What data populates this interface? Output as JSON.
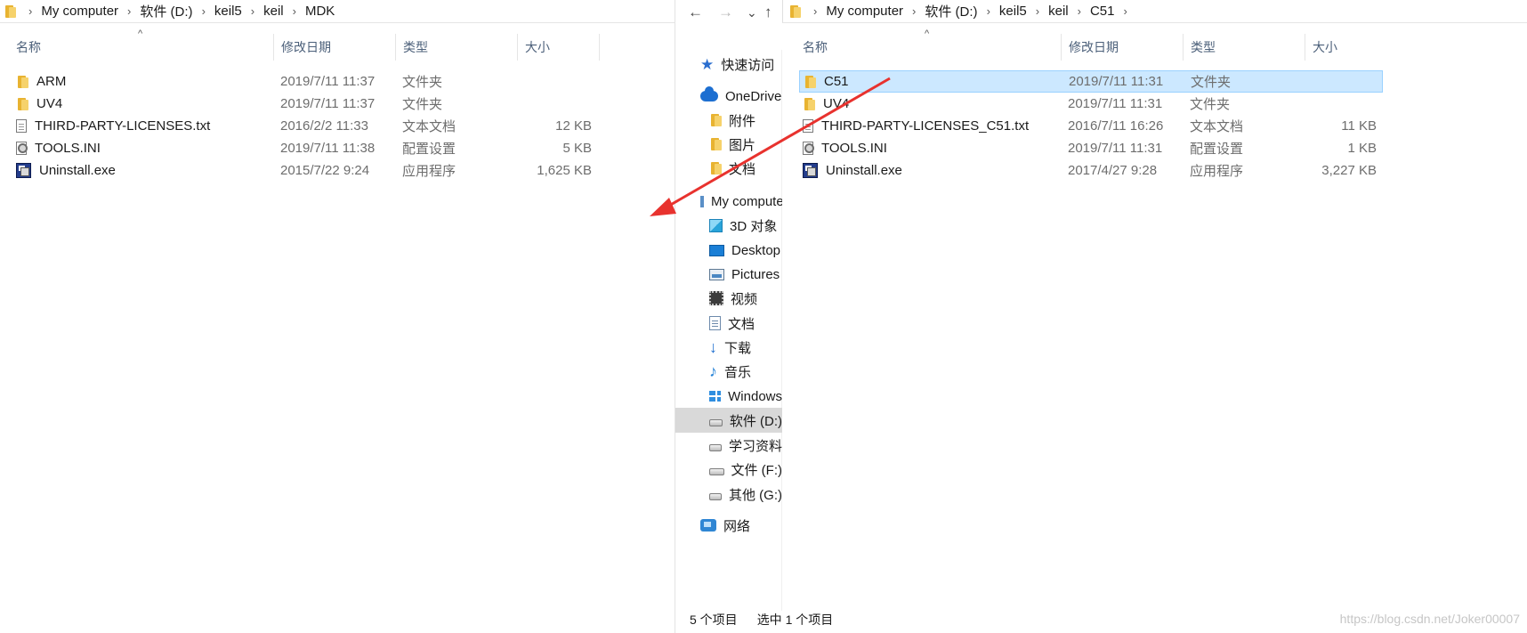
{
  "left": {
    "breadcrumb": [
      "My computer",
      "软件 (D:)",
      "keil5",
      "keil",
      "MDK"
    ],
    "columns": {
      "name": "名称",
      "date": "修改日期",
      "type": "类型",
      "size": "大小"
    },
    "files": [
      {
        "name": "ARM",
        "date": "2019/7/11 11:37",
        "type": "文件夹",
        "size": "",
        "icon": "folder-icon"
      },
      {
        "name": "UV4",
        "date": "2019/7/11 11:37",
        "type": "文件夹",
        "size": "",
        "icon": "folder-icon"
      },
      {
        "name": "THIRD-PARTY-LICENSES.txt",
        "date": "2016/2/2 11:33",
        "type": "文本文档",
        "size": "12 KB",
        "icon": "text-file-icon"
      },
      {
        "name": "TOOLS.INI",
        "date": "2019/7/11 11:38",
        "type": "配置设置",
        "size": "5 KB",
        "icon": "ini-file-icon"
      },
      {
        "name": "Uninstall.exe",
        "date": "2015/7/22 9:24",
        "type": "应用程序",
        "size": "1,625 KB",
        "icon": "exe-icon"
      }
    ]
  },
  "right": {
    "nav_buttons": {
      "back": "←",
      "forward": "→",
      "recent": "⌄",
      "up": "↑"
    },
    "breadcrumb": [
      "My computer",
      "软件 (D:)",
      "keil5",
      "keil",
      "C51"
    ],
    "columns": {
      "name": "名称",
      "date": "修改日期",
      "type": "类型",
      "size": "大小"
    },
    "files": [
      {
        "name": "C51",
        "date": "2019/7/11 11:31",
        "type": "文件夹",
        "size": "",
        "icon": "folder-icon",
        "selected": true
      },
      {
        "name": "UV4",
        "date": "2019/7/11 11:31",
        "type": "文件夹",
        "size": "",
        "icon": "folder-icon"
      },
      {
        "name": "THIRD-PARTY-LICENSES_C51.txt",
        "date": "2016/7/11 16:26",
        "type": "文本文档",
        "size": "11 KB",
        "icon": "text-file-icon"
      },
      {
        "name": "TOOLS.INI",
        "date": "2019/7/11 11:31",
        "type": "配置设置",
        "size": "1 KB",
        "icon": "ini-file-icon"
      },
      {
        "name": "Uninstall.exe",
        "date": "2017/4/27 9:28",
        "type": "应用程序",
        "size": "3,227 KB",
        "icon": "exe-icon"
      }
    ],
    "tree": [
      {
        "label": "快速访问",
        "icon": "star-icon"
      },
      {
        "label": "OneDrive",
        "icon": "onedrive-icon"
      },
      {
        "label": "附件",
        "icon": "folder-icon"
      },
      {
        "label": "图片",
        "icon": "folder-icon"
      },
      {
        "label": "文档",
        "icon": "folder-icon"
      },
      {
        "label": "My computer",
        "icon": "computer-icon"
      },
      {
        "label": "3D 对象",
        "icon": "cube-icon"
      },
      {
        "label": "Desktop",
        "icon": "desktop-icon"
      },
      {
        "label": "Pictures",
        "icon": "pictures-icon"
      },
      {
        "label": "视频",
        "icon": "video-icon"
      },
      {
        "label": "文档",
        "icon": "document-icon"
      },
      {
        "label": "下载",
        "icon": "download-icon"
      },
      {
        "label": "音乐",
        "icon": "music-icon"
      },
      {
        "label": "Windows",
        "icon": "windows-drive-icon"
      },
      {
        "label": "软件 (D:)",
        "icon": "drive-icon",
        "selected": true
      },
      {
        "label": "学习资料",
        "icon": "drive-icon"
      },
      {
        "label": "文件 (F:)",
        "icon": "drive-icon"
      },
      {
        "label": "其他 (G:)",
        "icon": "drive-icon"
      },
      {
        "label": "网络",
        "icon": "network-icon"
      }
    ],
    "status": {
      "items": "5 个项目",
      "selected": "选中 1 个项目"
    }
  },
  "annotation": {
    "color": "#e8322e"
  },
  "watermark": "https://blog.csdn.net/Joker00007"
}
